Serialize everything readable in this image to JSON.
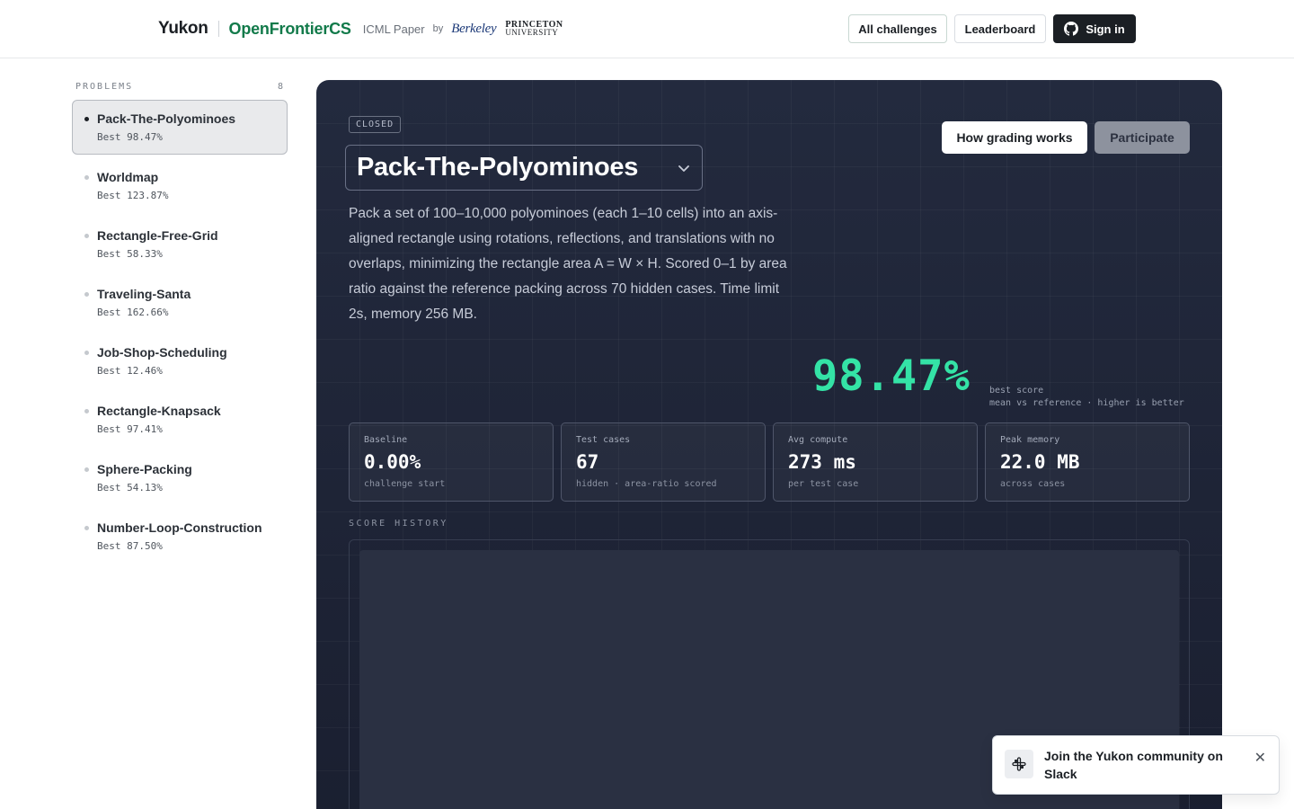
{
  "header": {
    "brand": "Yukon",
    "project": "OpenFrontierCS",
    "paper": "ICML Paper",
    "by": "by",
    "berkeley": "Berkeley",
    "princeton_line1": "PRINCETON",
    "princeton_line2": "UNIVERSITY",
    "nav": {
      "all_challenges": "All challenges",
      "leaderboard": "Leaderboard",
      "sign_in": "Sign in"
    }
  },
  "sidebar": {
    "heading": "PROBLEMS",
    "count": "8",
    "items": [
      {
        "name": "Pack-The-Polyominoes",
        "best": "Best 98.47%"
      },
      {
        "name": "Worldmap",
        "best": "Best 123.87%"
      },
      {
        "name": "Rectangle-Free-Grid",
        "best": "Best 58.33%"
      },
      {
        "name": "Traveling-Santa",
        "best": "Best 162.66%"
      },
      {
        "name": "Job-Shop-Scheduling",
        "best": "Best 12.46%"
      },
      {
        "name": "Rectangle-Knapsack",
        "best": "Best 97.41%"
      },
      {
        "name": "Sphere-Packing",
        "best": "Best 54.13%"
      },
      {
        "name": "Number-Loop-Construction",
        "best": "Best 87.50%"
      }
    ]
  },
  "problem": {
    "status": "CLOSED",
    "title": "Pack-The-Polyominoes",
    "description": "Pack a set of 100–10,000 polyominoes (each 1–10 cells) into an axis-aligned rectangle using rotations, reflections, and translations with no overlaps, minimizing the rectangle area A = W × H. Scored 0–1 by area ratio against the reference packing across 70 hidden cases. Time limit 2s, memory 256 MB.",
    "how_grading_label": "How grading works",
    "participate_label": "Participate",
    "best_score": "98.47%",
    "best_score_label": "best score",
    "best_score_note": "mean vs reference · higher is better",
    "stats": [
      {
        "label": "Baseline",
        "value": "0.00%",
        "sub": "challenge start"
      },
      {
        "label": "Test cases",
        "value": "67",
        "sub": "hidden · area-ratio scored"
      },
      {
        "label": "Avg compute",
        "value": "273 ms",
        "sub": "per test case"
      },
      {
        "label": "Peak memory",
        "value": "22.0 MB",
        "sub": "across cases"
      }
    ],
    "history_label": "SCORE HISTORY"
  },
  "toast": {
    "text": "Join the Yukon community on Slack",
    "icon": "slack-icon"
  },
  "colors": {
    "accent_green": "#34e3a6",
    "brand_green": "#127a4a",
    "panel_bg": "#1e2436"
  }
}
